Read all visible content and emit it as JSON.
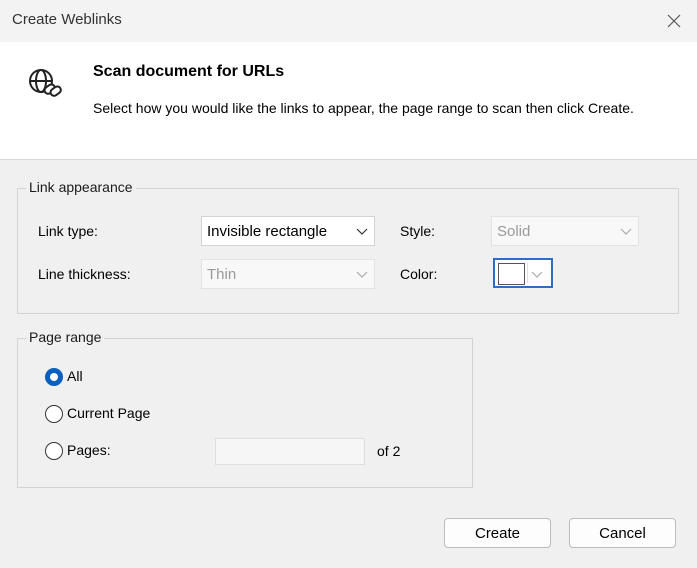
{
  "window": {
    "title": "Create Weblinks"
  },
  "header": {
    "title": "Scan document for URLs",
    "description": "Select how you would like the links to appear, the page range to scan then click Create."
  },
  "link_appearance": {
    "legend": "Link appearance",
    "link_type_label": "Link type:",
    "link_type_value": "Invisible rectangle",
    "style_label": "Style:",
    "style_value": "Solid",
    "line_thickness_label": "Line thickness:",
    "line_thickness_value": "Thin",
    "color_label": "Color:",
    "color_value": "#ffffff"
  },
  "page_range": {
    "legend": "Page range",
    "options": [
      "All",
      "Current Page",
      "Pages:"
    ],
    "selected": "All",
    "pages_placeholder": "",
    "of_label": "of 2"
  },
  "buttons": {
    "create": "Create",
    "cancel": "Cancel"
  },
  "colors": {
    "accent": "#0a5fbf"
  }
}
